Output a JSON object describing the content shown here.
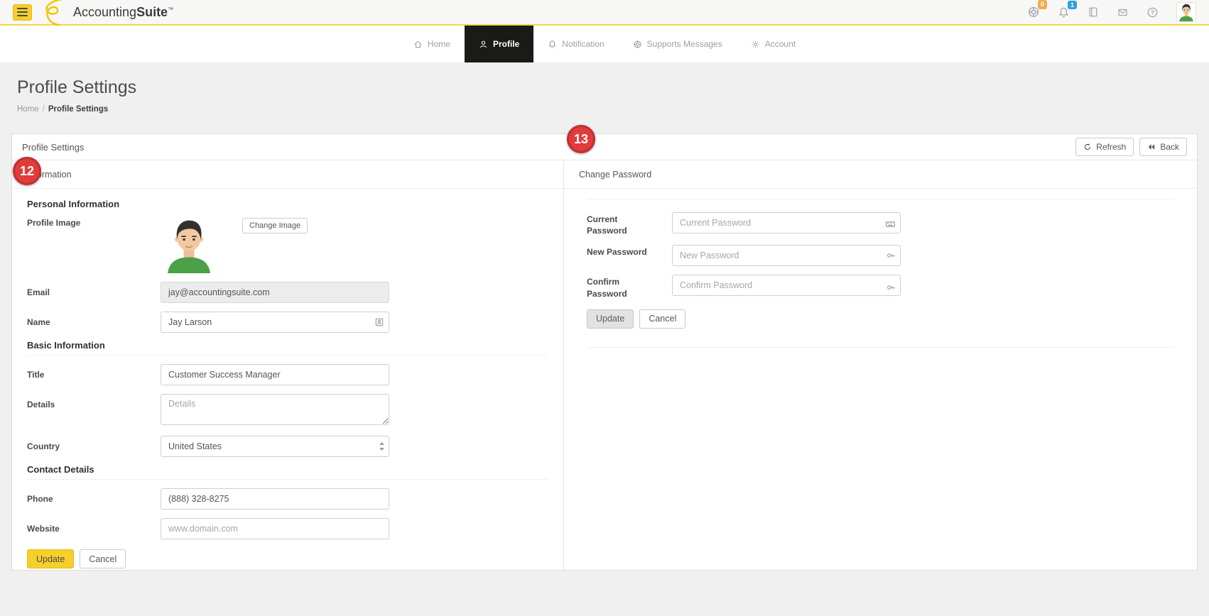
{
  "header": {
    "logo_accounting": "Accounting",
    "logo_suite": "Suite",
    "logo_tm": "™",
    "help_badge": "0",
    "notification_badge": "1"
  },
  "nav": {
    "home": "Home",
    "profile": "Profile",
    "notification": "Notification",
    "supports": "Supports Messages",
    "account": "Account"
  },
  "page": {
    "title": "Profile Settings",
    "breadcrumb_home": "Home",
    "breadcrumb_separator": "/",
    "breadcrumb_current": "Profile Settings"
  },
  "panel": {
    "title": "Profile Settings",
    "refresh": "Refresh",
    "back": "Back"
  },
  "info": {
    "section_title": "Information",
    "personal_heading": "Personal Information",
    "profile_image_label": "Profile Image",
    "change_image": "Change Image",
    "email_label": "Email",
    "email_value": "jay@accountingsuite.com",
    "name_label": "Name",
    "name_value": "Jay Larson",
    "basic_heading": "Basic Information",
    "title_label": "Title",
    "title_value": "Customer Success Manager",
    "details_label": "Details",
    "details_placeholder": "Details",
    "country_label": "Country",
    "country_value": "United States",
    "contact_heading": "Contact Details",
    "phone_label": "Phone",
    "phone_value": "(888) 328-8275",
    "website_label": "Website",
    "website_placeholder": "www.domain.com",
    "update": "Update",
    "cancel": "Cancel"
  },
  "password": {
    "section_title": "Change Password",
    "current_label": "Current Password",
    "current_placeholder": "Current Password",
    "new_label": "New Password",
    "new_placeholder": "New Password",
    "confirm_label": "Confirm Password",
    "confirm_placeholder": "Confirm Password",
    "update": "Update",
    "cancel": "Cancel"
  },
  "annotations": {
    "badge_12": "12",
    "badge_13": "13"
  },
  "icons": {
    "hamburger-menu-icon": "three-bars",
    "logo-swoosh-icon": "yellow-curve",
    "life-ring-icon": "circle-spokes",
    "bell-icon": "bell",
    "book-icon": "book",
    "envelope-icon": "envelope",
    "question-icon": "?",
    "home-icon": "house",
    "person-icon": "person",
    "gear-icon": "gear",
    "refresh-icon": "circular-arrow",
    "back-icon": "double-left-triangles",
    "keyboard-autofill-icon": "keyboard",
    "key-autofill-icon": "key",
    "contact-autofill-icon": "contact-card",
    "select-arrows-icon": "up-down-triangles"
  },
  "colors": {
    "accent_yellow": "#f6ce2f",
    "active_tab_bg": "#1a1a18",
    "badge_orange": "#f0ad4e",
    "badge_blue": "#2e9fe0",
    "annotation_red": "#e23b3b",
    "page_bg": "#f0f0f1"
  }
}
